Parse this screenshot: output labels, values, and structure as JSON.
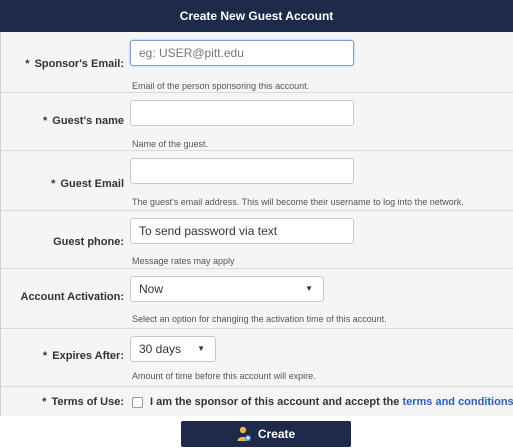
{
  "title": "Create New Guest Account",
  "fields": {
    "sponsor_email": {
      "label": "Sponsor's Email:",
      "placeholder": "eg: USER@pitt.edu",
      "help": "Email of the person sponsoring this account."
    },
    "guest_name": {
      "label": "Guest's name",
      "placeholder": "",
      "help": "Name of the guest."
    },
    "guest_email": {
      "label": "Guest Email",
      "placeholder": "",
      "help": "The guest's email address. This will become their username to log into the network."
    },
    "guest_phone": {
      "label": "Guest phone:",
      "placeholder": "To send password via text",
      "help": "Message rates may apply"
    },
    "account_activation": {
      "label": "Account Activation:",
      "selected": "Now",
      "help": "Select an option for changing the activation time of this account."
    },
    "expires_after": {
      "label": "Expires After:",
      "selected": "30 days",
      "help": "Amount of time before this account will expire."
    },
    "terms": {
      "label": "Terms of Use:",
      "text": "I am the sponsor of this account and accept the ",
      "link_text": "terms and conditions",
      "checked": false
    }
  },
  "required_marker": "*",
  "create_button": {
    "label": "Create",
    "icon": "user-icon"
  },
  "colors": {
    "header_bg": "#1e2a4a",
    "panel_bg": "#f5f5f5",
    "link": "#2a62b8"
  }
}
